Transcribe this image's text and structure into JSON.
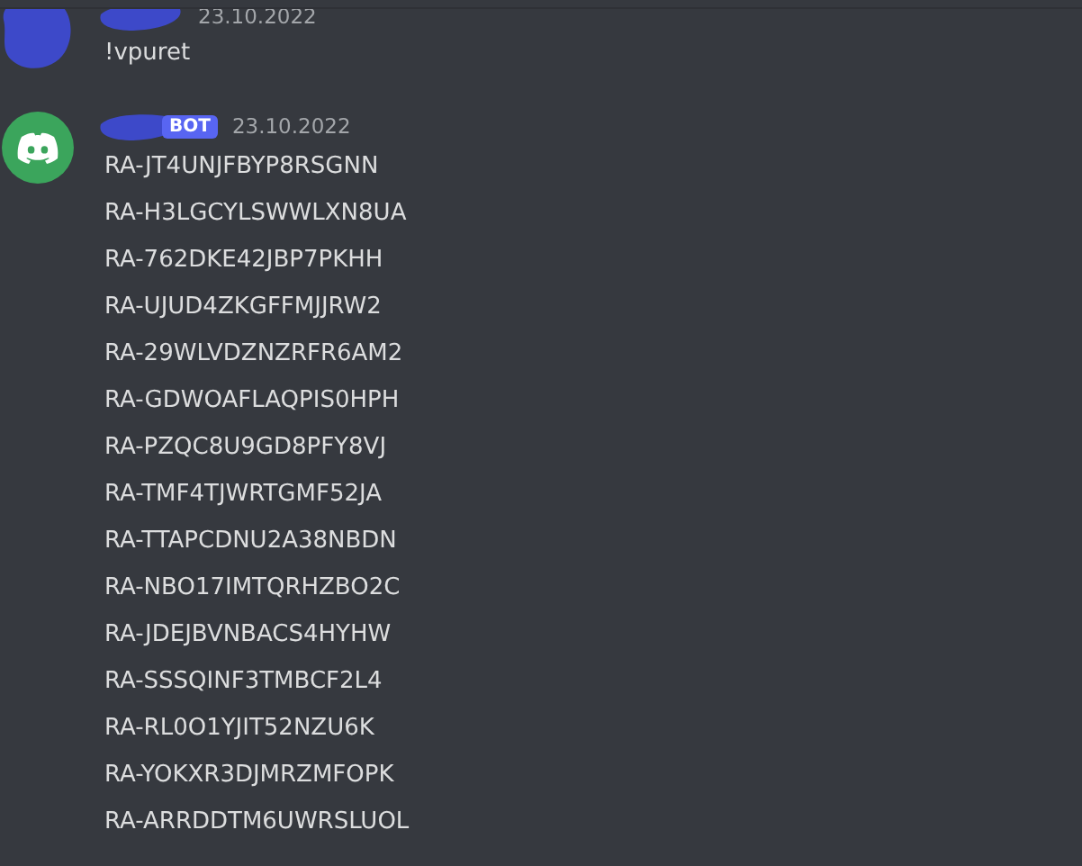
{
  "messages": [
    {
      "kind": "user",
      "timestamp": "23.10.2022",
      "lines": [
        "!vpuret"
      ]
    },
    {
      "kind": "bot",
      "badge": "BOT",
      "timestamp": "23.10.2022",
      "lines": [
        "RA-JT4UNJFBYP8RSGNN",
        "RA-H3LGCYLSWWLXN8UA",
        "RA-762DKE42JBP7PKHH",
        "RA-UJUD4ZKGFFMJJRW2",
        "RA-29WLVDZNZRFR6AM2",
        "RA-GDWOAFLAQPIS0HPH",
        "RA-PZQC8U9GD8PFY8VJ",
        "RA-TMF4TJWRTGMF52JA",
        "RA-TTAPCDNU2A38NBDN",
        "RA-NBO17IMTQRHZBO2C",
        "RA-JDEJBVNBACS4HYHW",
        "RA-SSSQINF3TMBCF2L4",
        "RA-RL0O1YJIT52NZU6K",
        "RA-YOKXR3DJMRZMFOPK",
        "RA-ARRDDTM6UWRSLUOL"
      ]
    }
  ]
}
